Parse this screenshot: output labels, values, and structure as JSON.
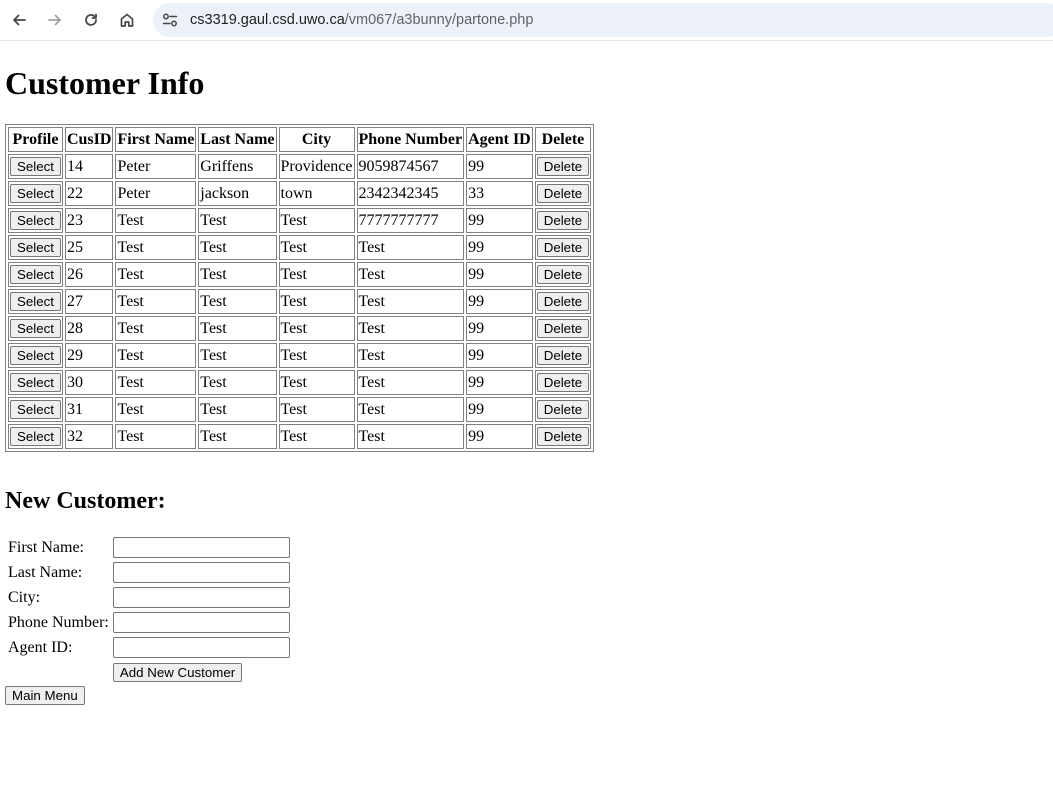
{
  "browser": {
    "url_host": "cs3319.gaul.csd.uwo.ca",
    "url_path": "/vm067/a3bunny/partone.php"
  },
  "page": {
    "title": "Customer Info",
    "table": {
      "headers": [
        "Profile",
        "CusID",
        "First Name",
        "Last Name",
        "City",
        "Phone Number",
        "Agent ID",
        "Delete"
      ],
      "select_label": "Select",
      "delete_label": "Delete",
      "rows": [
        {
          "cusid": "14",
          "first": "Peter",
          "last": "Griffens",
          "city": "Providence",
          "phone": "9059874567",
          "agent": "99"
        },
        {
          "cusid": "22",
          "first": "Peter",
          "last": "jackson",
          "city": "town",
          "phone": "2342342345",
          "agent": "33"
        },
        {
          "cusid": "23",
          "first": "Test",
          "last": "Test",
          "city": "Test",
          "phone": "7777777777",
          "agent": "99"
        },
        {
          "cusid": "25",
          "first": "Test",
          "last": "Test",
          "city": "Test",
          "phone": "Test",
          "agent": "99"
        },
        {
          "cusid": "26",
          "first": "Test",
          "last": "Test",
          "city": "Test",
          "phone": "Test",
          "agent": "99"
        },
        {
          "cusid": "27",
          "first": "Test",
          "last": "Test",
          "city": "Test",
          "phone": "Test",
          "agent": "99"
        },
        {
          "cusid": "28",
          "first": "Test",
          "last": "Test",
          "city": "Test",
          "phone": "Test",
          "agent": "99"
        },
        {
          "cusid": "29",
          "first": "Test",
          "last": "Test",
          "city": "Test",
          "phone": "Test",
          "agent": "99"
        },
        {
          "cusid": "30",
          "first": "Test",
          "last": "Test",
          "city": "Test",
          "phone": "Test",
          "agent": "99"
        },
        {
          "cusid": "31",
          "first": "Test",
          "last": "Test",
          "city": "Test",
          "phone": "Test",
          "agent": "99"
        },
        {
          "cusid": "32",
          "first": "Test",
          "last": "Test",
          "city": "Test",
          "phone": "Test",
          "agent": "99"
        }
      ]
    },
    "new_customer": {
      "heading": "New Customer:",
      "fields": [
        {
          "label": "First Name:",
          "value": ""
        },
        {
          "label": "Last Name:",
          "value": ""
        },
        {
          "label": "City:",
          "value": ""
        },
        {
          "label": "Phone Number:",
          "value": ""
        },
        {
          "label": "Agent ID:",
          "value": ""
        }
      ],
      "submit_label": "Add New Customer"
    },
    "main_menu_label": "Main Menu"
  }
}
